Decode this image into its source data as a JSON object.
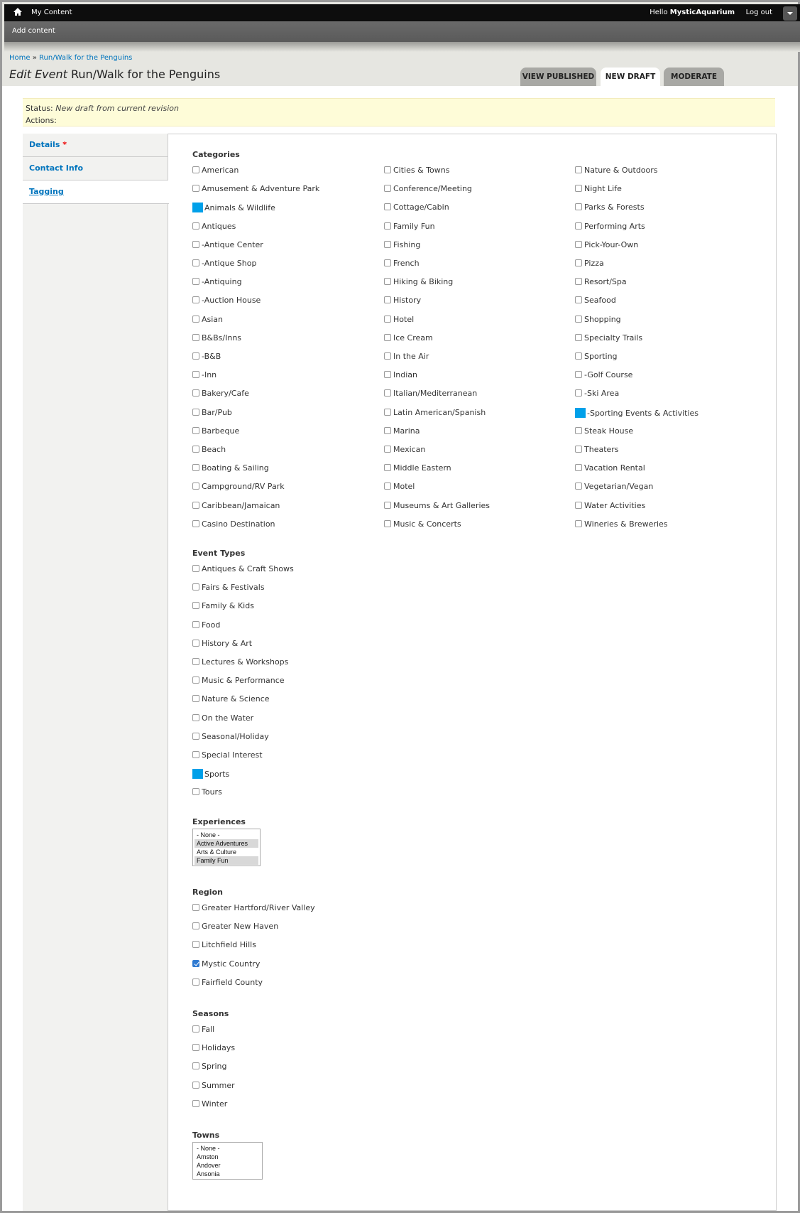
{
  "toolbar": {
    "my_content": "My Content",
    "hello_prefix": "Hello ",
    "username": "MysticAquarium",
    "logout": "Log out",
    "add_content": "Add content"
  },
  "breadcrumb": [
    "Home",
    "»",
    "Run/Walk for the Penguins"
  ],
  "title": {
    "prefix": "Edit Event",
    "name": "Run/Walk for the Penguins"
  },
  "tabs": [
    "VIEW PUBLISHED",
    "NEW DRAFT",
    "MODERATE"
  ],
  "status": {
    "label": "Status:",
    "value": "New draft from current revision",
    "actions": "Actions:"
  },
  "vtabs": [
    {
      "label": "Details",
      "required": "*"
    },
    {
      "label": "Contact Info"
    },
    {
      "label": "Tagging"
    }
  ],
  "categories": {
    "legend": "Categories",
    "columns": [
      [
        "American",
        "Amusement & Adventure Park",
        "Animals & Wildlife",
        "Antiques",
        "-Antique Center",
        "-Antique Shop",
        "-Antiquing",
        "-Auction House",
        "Asian",
        "B&Bs/Inns",
        "-B&B",
        "-Inn",
        "Bakery/Cafe",
        "Bar/Pub",
        "Barbeque",
        "Beach",
        "Boating & Sailing",
        "Campground/RV Park",
        "Caribbean/Jamaican",
        "Casino Destination"
      ],
      [
        "Cities & Towns",
        "Conference/Meeting",
        "Cottage/Cabin",
        "Family Fun",
        "Fishing",
        "French",
        "Hiking & Biking",
        "History",
        "Hotel",
        "Ice Cream",
        "In the Air",
        "Indian",
        "Italian/Mediterranean",
        "Latin American/Spanish",
        "Marina",
        "Mexican",
        "Middle Eastern",
        "Motel",
        "Museums & Art Galleries",
        "Music & Concerts"
      ],
      [
        "Nature & Outdoors",
        "Night Life",
        "Parks & Forests",
        "Performing Arts",
        "Pick-Your-Own",
        "Pizza",
        "Resort/Spa",
        "Seafood",
        "Shopping",
        "Specialty Trails",
        "Sporting",
        "-Golf Course",
        "-Ski Area",
        "-Sporting Events & Activities",
        "Steak House",
        "Theaters",
        "Vacation Rental",
        "Vegetarian/Vegan",
        "Water Activities",
        "Wineries & Breweries"
      ]
    ]
  },
  "event_types": {
    "legend": "Event Types",
    "items": [
      "Antiques & Craft Shows",
      "Fairs & Festivals",
      "Family & Kids",
      "Food",
      "History & Art",
      "Lectures & Workshops",
      "Music & Performance",
      "Nature & Science",
      "On the Water",
      "Seasonal/Holiday",
      "Special Interest",
      "Sports",
      "Tours"
    ]
  },
  "experiences": {
    "legend": "Experiences",
    "options": [
      "- None -",
      "Active Adventures",
      "Arts & Culture",
      "Family Fun"
    ],
    "selected": [
      "Active Adventures",
      "Family Fun"
    ]
  },
  "region": {
    "legend": "Region",
    "items": [
      "Greater Hartford/River Valley",
      "Greater New Haven",
      "Litchfield Hills",
      "Mystic Country",
      "Fairfield County"
    ],
    "checked": [
      "Mystic Country"
    ]
  },
  "seasons": {
    "legend": "Seasons",
    "items": [
      "Fall",
      "Holidays",
      "Spring",
      "Summer",
      "Winter"
    ]
  },
  "towns": {
    "legend": "Towns",
    "options": [
      "- None -",
      "Amston",
      "Andover",
      "Ansonia"
    ]
  },
  "highlighted": [
    "Animals & Wildlife",
    "-Sporting Events & Activities",
    "Sports"
  ],
  "colors": {
    "accent_link": "#0074bd",
    "focus_marker": "#00a0e9",
    "status_bg": "#fefcd8"
  }
}
